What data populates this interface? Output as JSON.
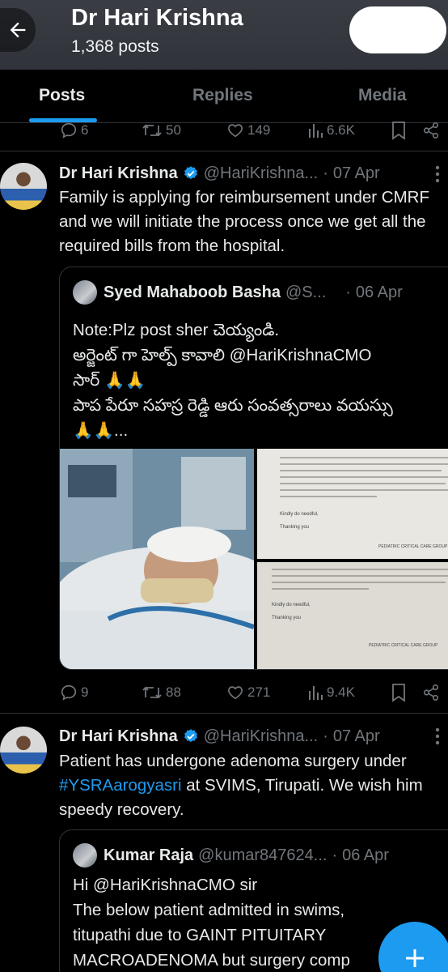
{
  "header": {
    "profile_name": "Dr Hari Krishna",
    "post_count": "1,368 posts"
  },
  "tabs": [
    {
      "label": "Posts",
      "active": true
    },
    {
      "label": "Replies",
      "active": false
    },
    {
      "label": "Media",
      "active": false
    }
  ],
  "top_actions": {
    "replies": "6",
    "reposts": "50",
    "likes": "149",
    "views": "6.6K"
  },
  "tweets": [
    {
      "author": "Dr Hari Krishna",
      "handle": "@HariKrishna...",
      "date": "07 Apr",
      "text": "Family is applying for reimbursement under CMRF and we will initiate the process once we get all the required bills from the hospital.",
      "quote": {
        "author": "Syed Mahaboob Basha",
        "handle": "@S...",
        "date": "06 Apr",
        "text_lines": [
          "Note:Plz post sher చెయ్యండి.",
          "అర్జెంట్ గా హెల్ప్ కావాలి @HariKrishnaCMO",
          "సార్ 🙏🙏",
          "పాప పేరూ సహస్ర రెడ్డి ఆరు సంవత్సరాలు వయస్సు",
          "🙏🙏..."
        ],
        "doc_top": {
          "kindly": "Kindly do needful,",
          "thanking": "Thanking you",
          "group": "PEDIATRIC CRITICAL CARE GROUP"
        },
        "doc_bottom": {
          "kindly": "Kindly do needful,",
          "thanking": "Thanking you",
          "group": "PEDIATRIC CRITICAL CARE GROUP"
        }
      },
      "actions": {
        "replies": "9",
        "reposts": "88",
        "likes": "271",
        "views": "9.4K"
      }
    },
    {
      "author": "Dr Hari Krishna",
      "handle": "@HariKrishna...",
      "date": "07 Apr",
      "text_before": "Patient has undergone adenoma surgery under ",
      "hashtag": "#YSRAarogyasri",
      "text_after": " at SVIMS, Tirupati. We wish him speedy recovery.",
      "quote": {
        "author": "Kumar Raja",
        "handle": "@kumar847624...",
        "date": "06 Apr",
        "text_lines": [
          "Hi @HariKrishnaCMO sir",
          "The below patient admitted in swims,",
          "titupathi due to GAINT PITUITARY",
          "MACROADENOMA but surgery comp"
        ]
      }
    }
  ],
  "colors": {
    "accent": "#1d9bf0",
    "background": "#000000",
    "muted": "#71767b"
  }
}
